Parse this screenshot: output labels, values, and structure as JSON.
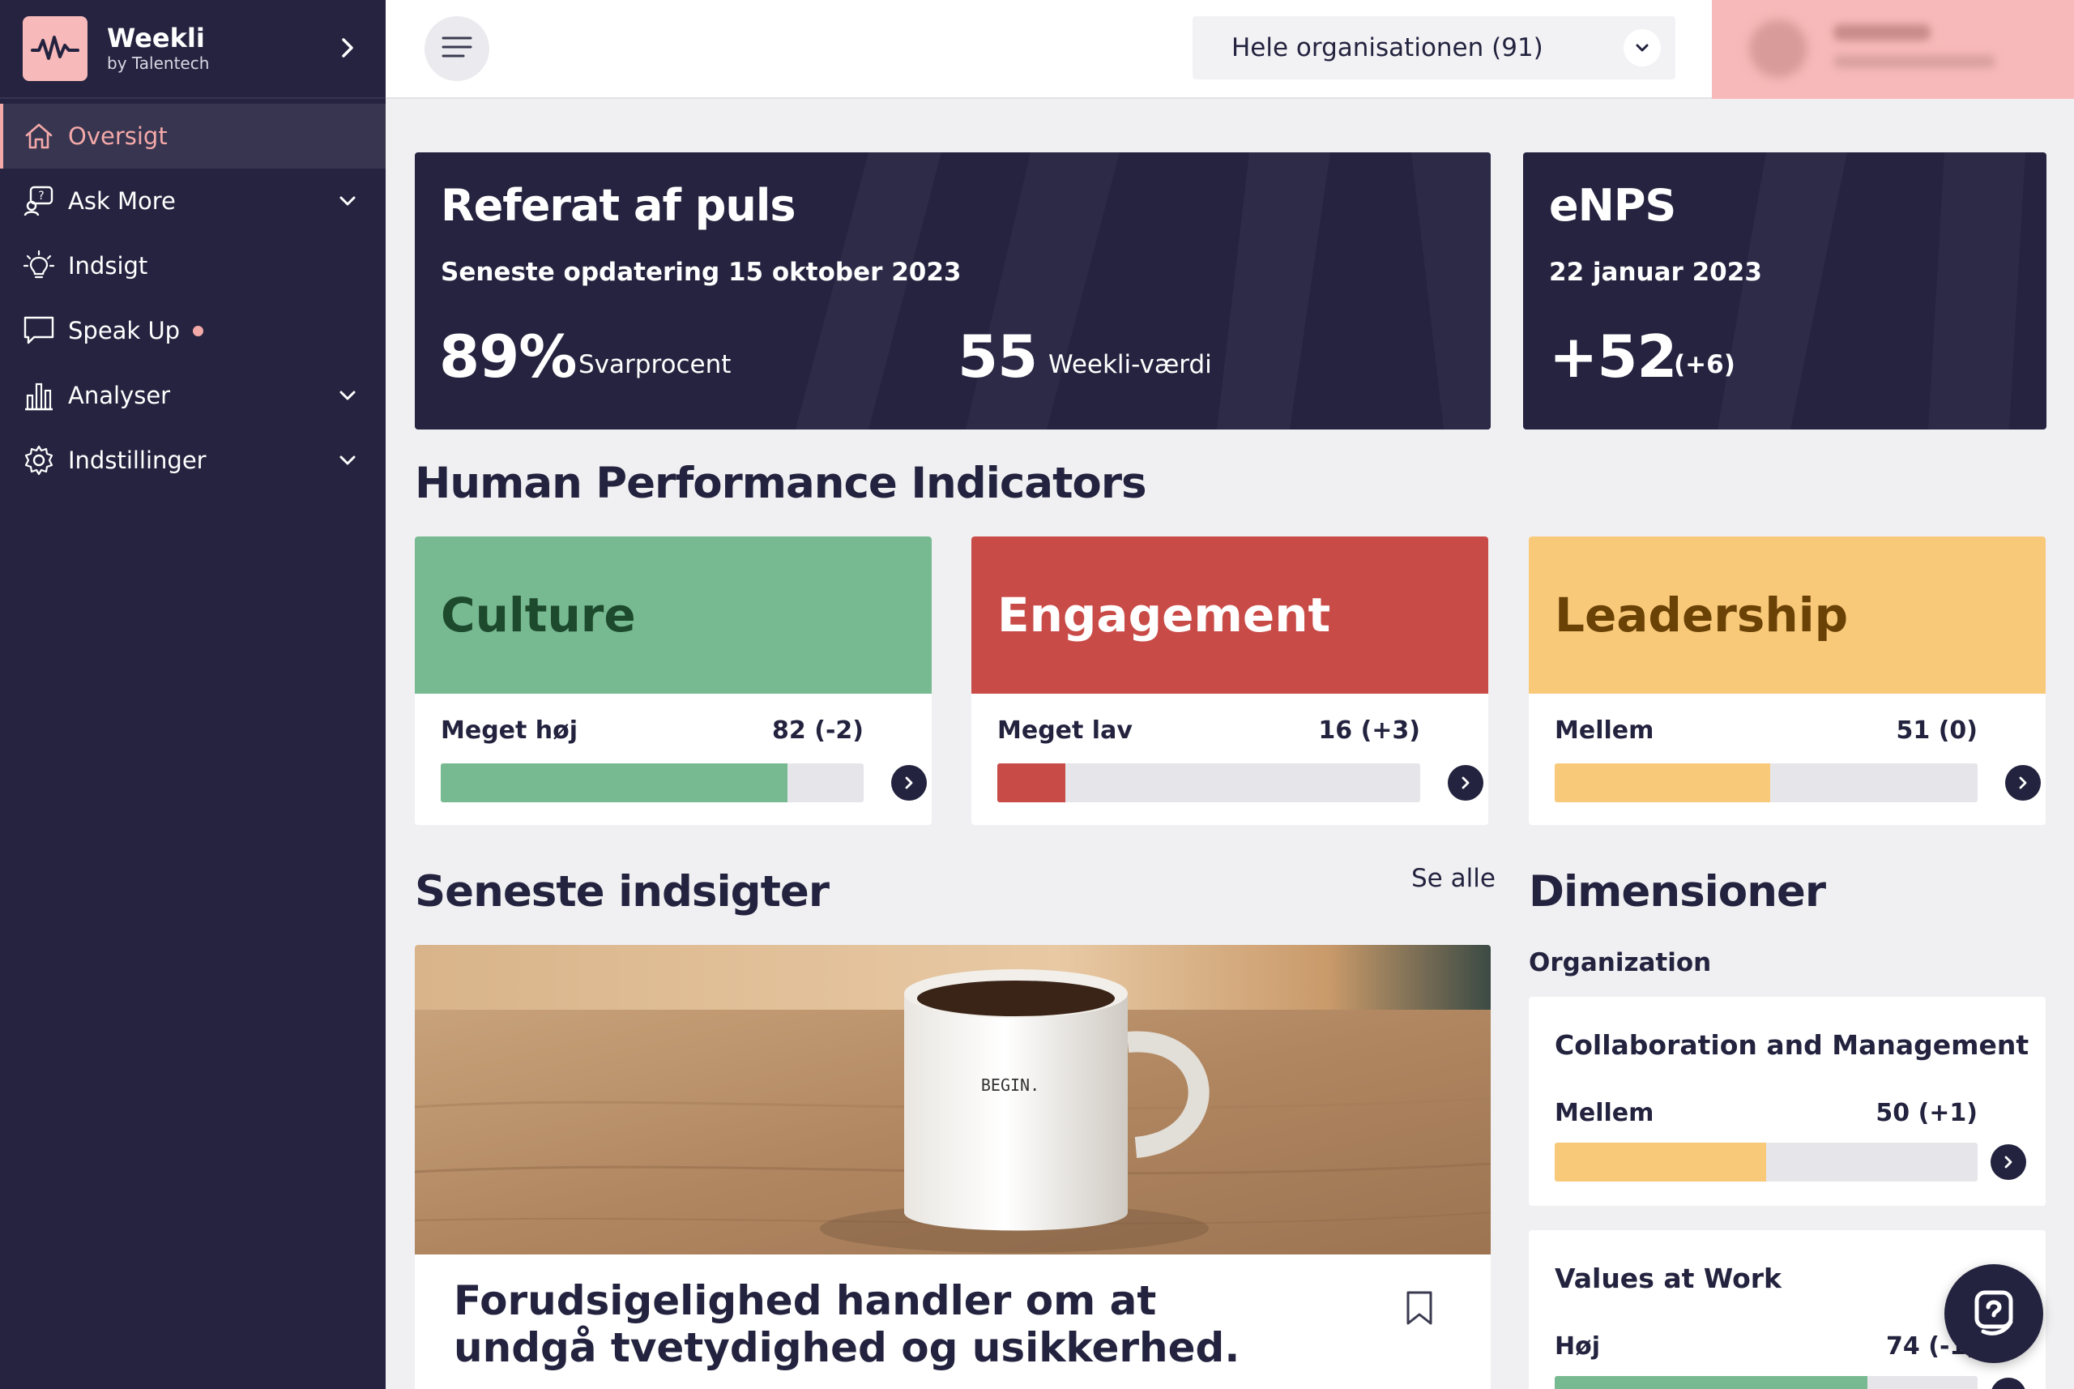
{
  "brand": {
    "name": "Weekli",
    "sub": "by Talentech"
  },
  "sidebar": {
    "items": [
      {
        "label": "Oversigt",
        "icon": "home-icon",
        "active": true
      },
      {
        "label": "Ask More",
        "icon": "ask-more-icon",
        "has_chevron": true
      },
      {
        "label": "Indsigt",
        "icon": "lightbulb-icon"
      },
      {
        "label": "Speak Up",
        "icon": "speech-bubble-icon",
        "has_dot": true
      },
      {
        "label": "Analyser",
        "icon": "bar-chart-icon",
        "has_chevron": true
      },
      {
        "label": "Indstillinger",
        "icon": "gear-icon",
        "has_chevron": true
      }
    ]
  },
  "topbar": {
    "org_select": "Hele organisationen (91)"
  },
  "pulse": {
    "title": "Referat af puls",
    "subtitle": "Seneste opdatering 15 oktober 2023",
    "response_value": "89%",
    "response_label": "Svarprocent",
    "weekli_value": "55",
    "weekli_label": "Weekli-værdi"
  },
  "enps": {
    "title": "eNPS",
    "date": "22 januar 2023",
    "value": "+52",
    "delta": "(+6)"
  },
  "hpi": {
    "title": "Human Performance Indicators",
    "cards": [
      {
        "name": "Culture",
        "level": "Meget høj",
        "score": "82 (-2)",
        "fill": 0.82,
        "head_color": "#77b991",
        "text_color": "#1d4a2c",
        "bar_color": "#77b991"
      },
      {
        "name": "Engagement",
        "level": "Meget lav",
        "score": "16 (+3)",
        "fill": 0.16,
        "head_color": "#c94b47",
        "text_color": "#ffffff",
        "bar_color": "#c94b47"
      },
      {
        "name": "Leadership",
        "level": "Mellem",
        "score": "51 (0)",
        "fill": 0.51,
        "head_color": "#f9c97a",
        "text_color": "#6a4206",
        "bar_color": "#f9c97a"
      }
    ]
  },
  "insights": {
    "title": "Seneste indsigter",
    "see_all": "Se alle",
    "card_title": "Forudsigelighed handler om at undgå tvetydighed og usikkerhed.",
    "mug_text": "BEGIN."
  },
  "dimensions": {
    "title": "Dimensioner",
    "group": "Organization",
    "cards": [
      {
        "name": "Collaboration and Management",
        "level": "Mellem",
        "score": "50 (+1)",
        "fill": 0.5,
        "bar_color": "#f9c97a"
      },
      {
        "name": "Values at Work",
        "level": "Høj",
        "score": "74 (-1)",
        "fill": 0.74,
        "bar_color": "#77b991"
      }
    ]
  },
  "colors": {
    "navy": "#25233f",
    "pink": "#f7b9b9",
    "green": "#77b991",
    "red": "#c94b47",
    "yellow": "#f9c97a"
  }
}
